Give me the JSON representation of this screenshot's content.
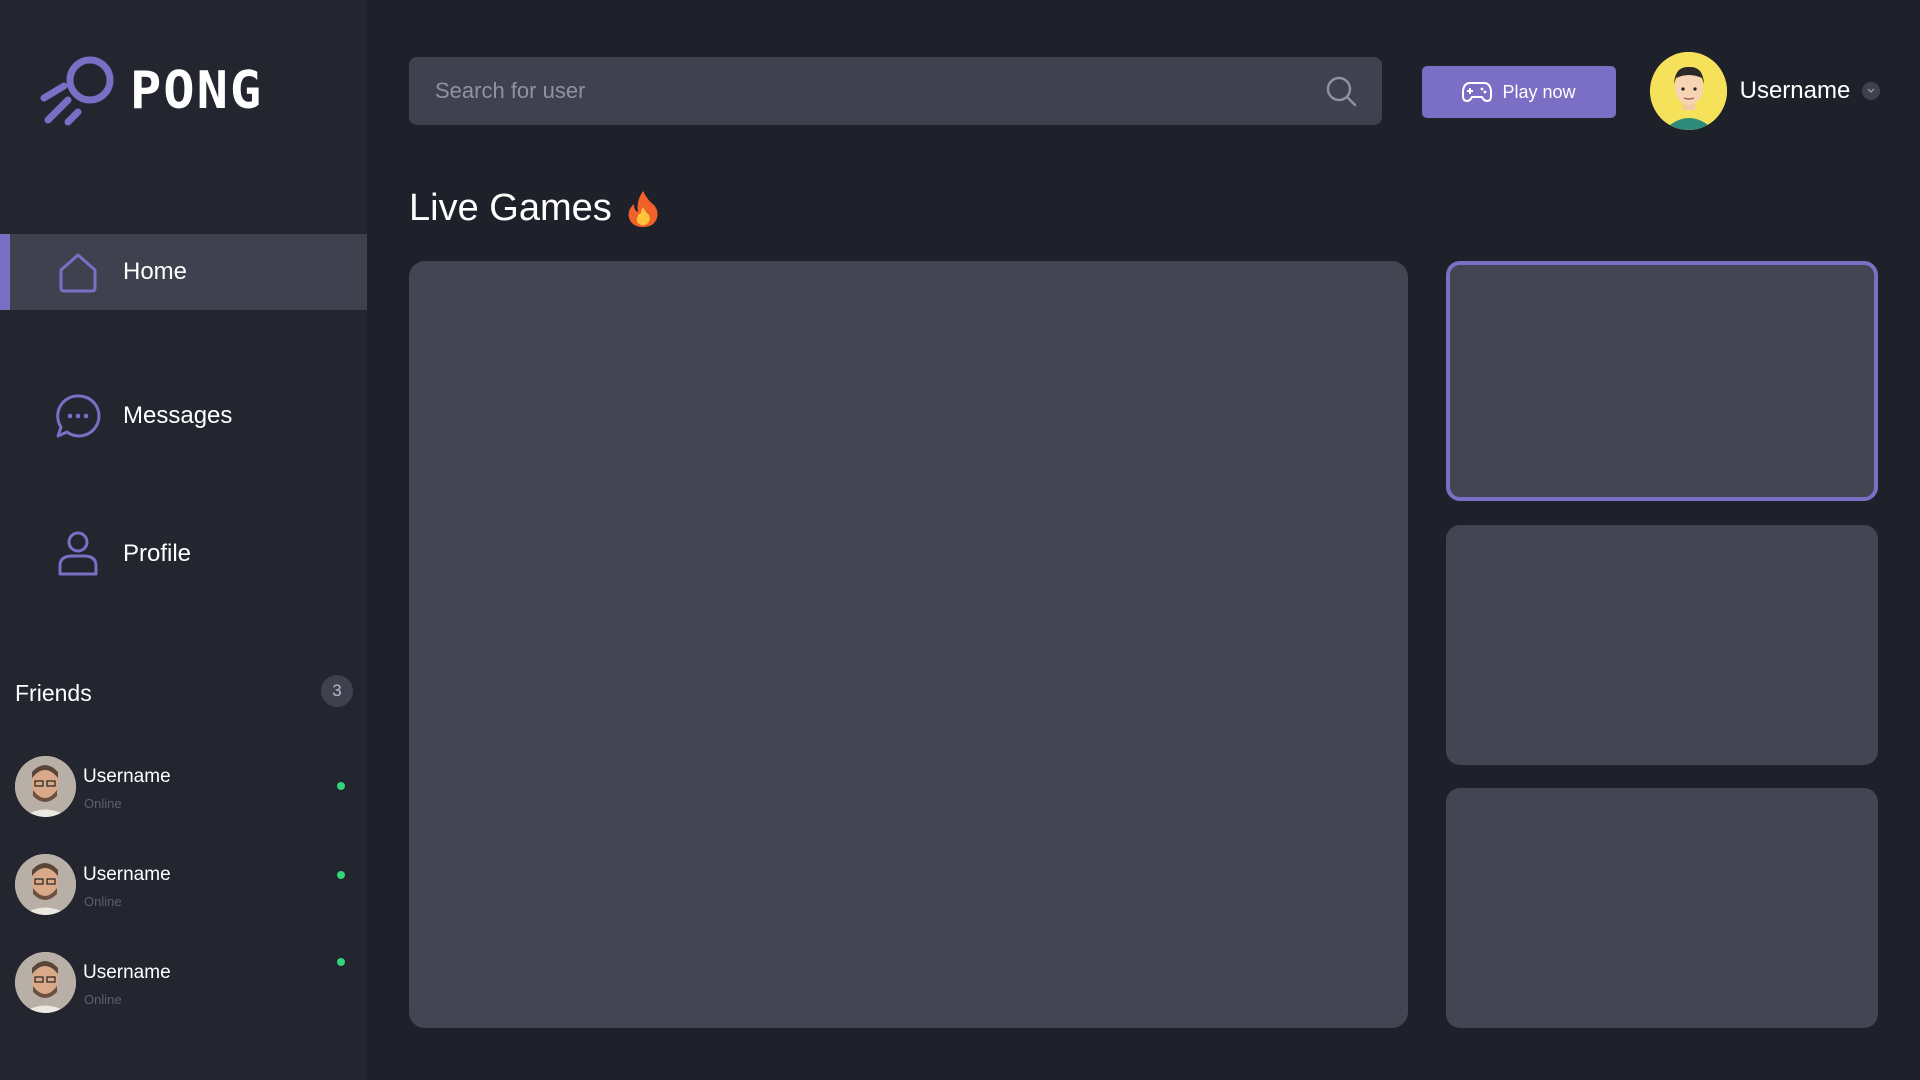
{
  "app": {
    "logo_text": "PONG"
  },
  "sidebar": {
    "items": [
      {
        "label": "Home",
        "icon": "home-icon",
        "active": true
      },
      {
        "label": "Messages",
        "icon": "chat-icon",
        "active": false
      },
      {
        "label": "Profile",
        "icon": "user-icon",
        "active": false
      }
    ],
    "friends": {
      "title": "Friends",
      "count": "3",
      "list": [
        {
          "name": "Username",
          "status": "Online"
        },
        {
          "name": "Username",
          "status": "Online"
        },
        {
          "name": "Username",
          "status": "Online"
        }
      ]
    }
  },
  "header": {
    "search_placeholder": "Search for user",
    "play_label": "Play now",
    "username": "Username"
  },
  "main": {
    "section_title": "Live Games",
    "section_icon": "fire-icon",
    "games": [
      {
        "type": "featured"
      },
      {
        "type": "card",
        "selected": true
      },
      {
        "type": "card",
        "selected": false
      },
      {
        "type": "card",
        "selected": false
      }
    ]
  },
  "colors": {
    "background": "#1f212a",
    "sidebar": "#23252f",
    "surface": "#434553",
    "accent": "#7a6fc4",
    "online": "#31d67b"
  }
}
